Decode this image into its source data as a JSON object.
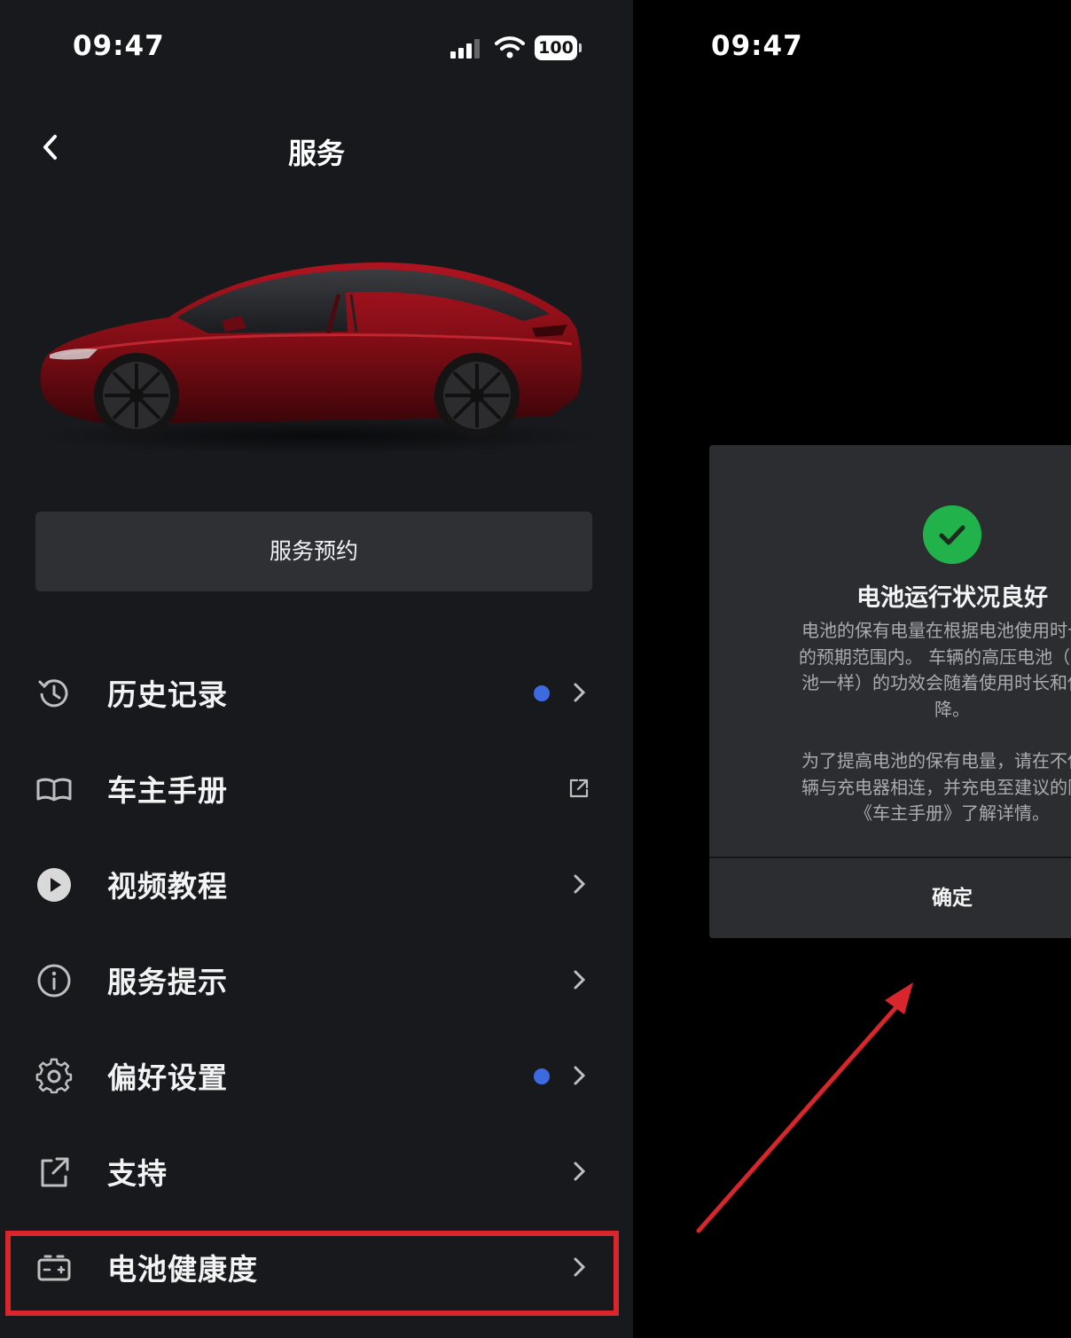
{
  "left_screen": {
    "status_bar": {
      "time": "09:47",
      "battery": "100"
    },
    "header": {
      "title": "服务"
    },
    "service_button_label": "服务预约",
    "menu": [
      {
        "label": "历史记录",
        "icon": "history-icon",
        "has_dot": true,
        "trailing": "chevron"
      },
      {
        "label": "车主手册",
        "icon": "book-icon",
        "has_dot": false,
        "trailing": "external-link"
      },
      {
        "label": "视频教程",
        "icon": "play-icon",
        "has_dot": false,
        "trailing": "chevron"
      },
      {
        "label": "服务提示",
        "icon": "info-icon",
        "has_dot": false,
        "trailing": "chevron"
      },
      {
        "label": "偏好设置",
        "icon": "gear-icon",
        "has_dot": true,
        "trailing": "chevron"
      },
      {
        "label": "支持",
        "icon": "external-link-icon",
        "has_dot": false,
        "trailing": "chevron"
      },
      {
        "label": "电池健康度",
        "icon": "battery-icon",
        "has_dot": false,
        "trailing": "chevron",
        "highlighted": true
      }
    ]
  },
  "right_screen": {
    "status_bar": {
      "time": "09:47"
    },
    "dialog": {
      "title": "电池运行状况良好",
      "body_lines": [
        "电池的保有电量在根据电池使用时长和",
        "的预期范围内。 车辆的高压电池（与所",
        "池一样）的功效会随着使用时长和使用",
        "降。",
        "",
        "为了提高电池的保有电量，请在不使用",
        "辆与充电器相连，并充电至建议的限值",
        "《车主手册》了解详情。"
      ],
      "confirm_label": "确定"
    }
  },
  "colors": {
    "left_background": "#17191c",
    "notification_dot": "#3e6ae1",
    "highlight_red": "#d8262c",
    "success_green": "#22b24c",
    "dialog_background": "#2c2d30"
  }
}
